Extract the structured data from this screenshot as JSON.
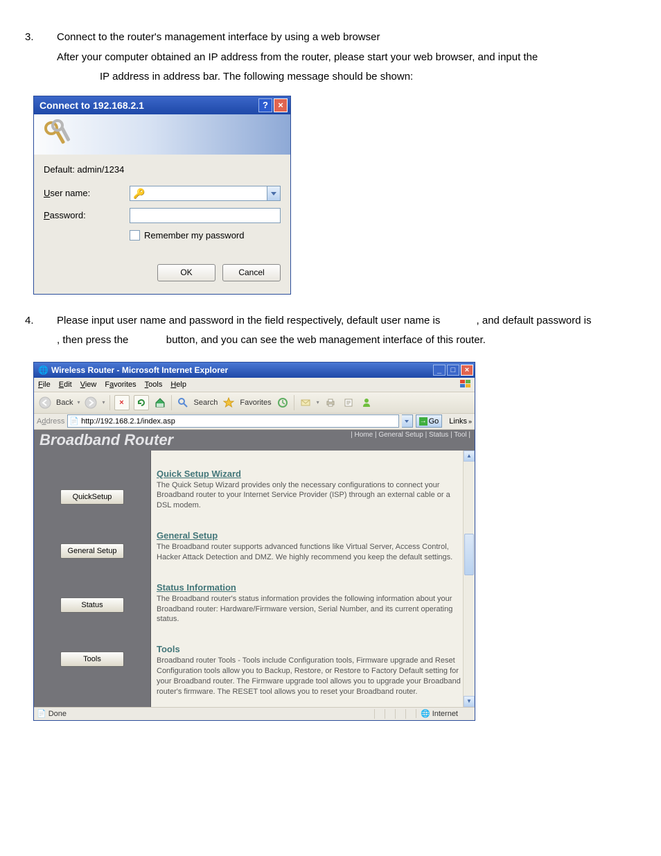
{
  "step3": {
    "num": "3.",
    "line1": "Connect to the router's management interface by using a web browser",
    "line2": "After your computer obtained an IP address from the router, please start your web browser, and input the",
    "line3": "IP address in address bar. The following message should be shown:"
  },
  "dialog": {
    "title": "Connect to 192.168.2.1",
    "default_text": "Default: admin/1234",
    "user_label_pre": "U",
    "user_label_post": "ser name:",
    "pass_label_pre": "P",
    "pass_label_post": "assword:",
    "remember_pre": "R",
    "remember_post": "emember my password",
    "ok": "OK",
    "cancel": "Cancel"
  },
  "step4": {
    "num": "4.",
    "text_a": "Please input user name and password in the field respectively, default user name is ",
    "text_b": ", and default password is",
    "line2_a": ", then press the ",
    "line2_b": " button, and you can see the web management interface of this router."
  },
  "ie": {
    "title": "Wireless Router - Microsoft Internet Explorer",
    "menu": {
      "file": "File",
      "edit": "Edit",
      "view": "View",
      "favorites": "Favorites",
      "tools": "Tools",
      "help": "Help"
    },
    "toolbar": {
      "back": "Back",
      "search": "Search",
      "favorites": "Favorites"
    },
    "address_label": "Address",
    "url": "http://192.168.2.1/index.asp",
    "go": "Go",
    "links": "Links",
    "status_done": "Done",
    "status_zone": "Internet"
  },
  "router": {
    "title": "Broadband Router",
    "nav": "| Home | General Setup | Status | Tool |",
    "buttons": {
      "quick": "QuickSetup",
      "general": "General Setup",
      "status": "Status",
      "tools": "Tools"
    },
    "sections": {
      "quick": {
        "h": "Quick Setup Wizard",
        "p": "The Quick Setup Wizard provides only the necessary configurations to connect your Broadband router to your Internet Service Provider (ISP) through an external cable or a DSL modem."
      },
      "general": {
        "h": "General Setup",
        "p": "The Broadband router supports advanced functions like Virtual Server, Access Control, Hacker Attack Detection and DMZ. We highly recommend you keep the default settings."
      },
      "status": {
        "h": "Status Information",
        "p": "The Broadband router's status information provides the following information about your Broadband router: Hardware/Firmware version, Serial Number, and its current operating status."
      },
      "tools": {
        "h": "Tools",
        "p": "Broadband router Tools - Tools include Configuration tools, Firmware upgrade and Reset Configuration tools allow you to Backup, Restore, or Restore to Factory Default setting for your Broadband router. The Firmware upgrade tool allows you to upgrade your Broadband router's firmware. The RESET tool allows you to reset your Broadband router."
      }
    }
  }
}
